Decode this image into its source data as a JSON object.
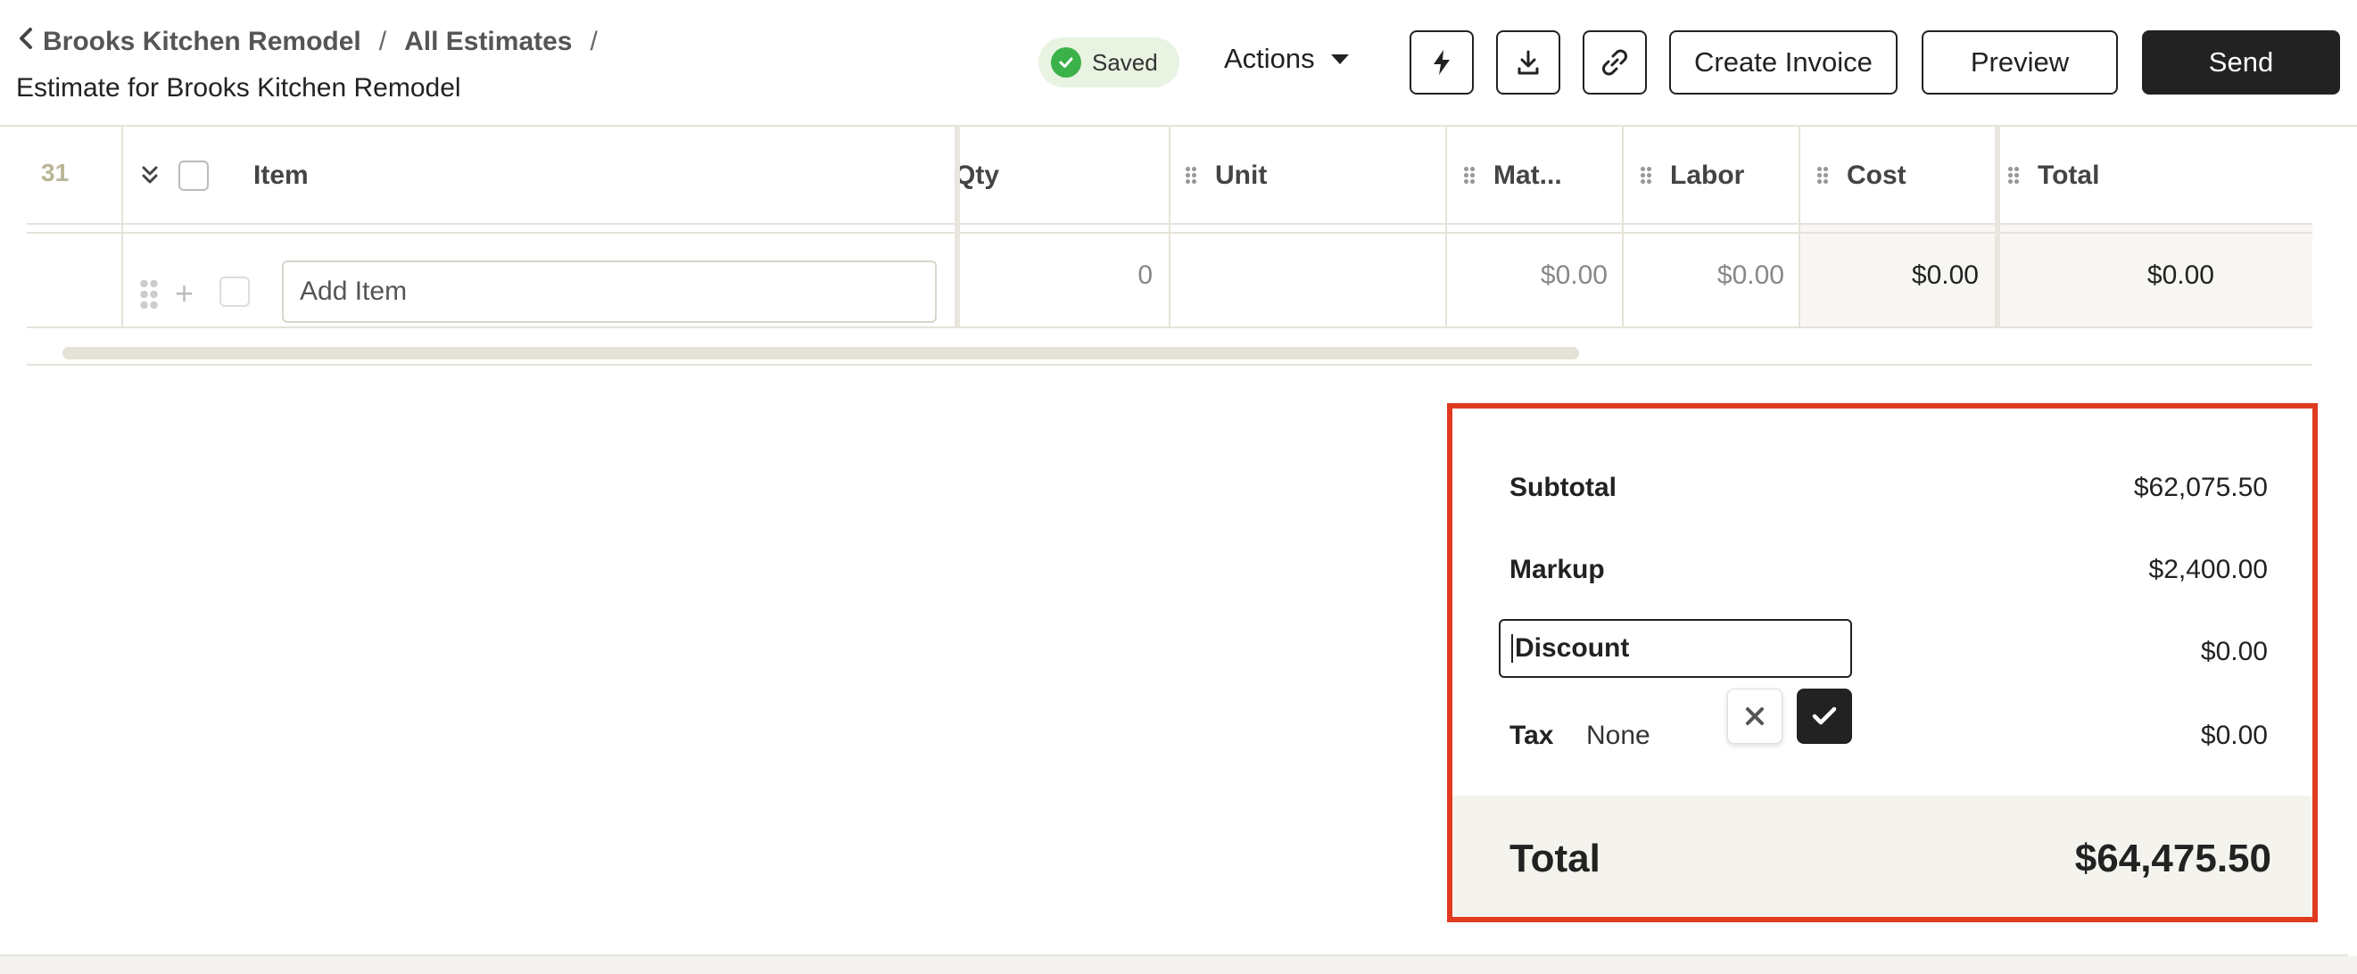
{
  "breadcrumb": {
    "project": "Brooks Kitchen Remodel",
    "estimates": "All Estimates",
    "separator": "/"
  },
  "page_title": "Estimate for Brooks Kitchen Remodel",
  "status": {
    "label": "Saved",
    "color": "#3bb14a"
  },
  "toolbar": {
    "actions_label": "Actions",
    "icons": [
      "lightning-icon",
      "download-icon",
      "link-icon"
    ],
    "create_invoice_label": "Create Invoice",
    "preview_label": "Preview",
    "send_label": "Send"
  },
  "table": {
    "row_number": "31",
    "columns": [
      "Item",
      "Qty",
      "Unit",
      "Mat...",
      "Labor",
      "Cost",
      "Total"
    ],
    "add_row": {
      "placeholder": "Add Item",
      "qty": "0",
      "unit": "",
      "material": "$0.00",
      "labor": "$0.00",
      "cost": "$0.00",
      "total": "$0.00"
    }
  },
  "summary": {
    "subtotal_label": "Subtotal",
    "subtotal_value": "$62,075.50",
    "markup_label": "Markup",
    "markup_value": "$2,400.00",
    "discount_label": "Discount",
    "discount_value": "$0.00",
    "tax_label": "Tax",
    "tax_rate": "None",
    "tax_value": "$0.00",
    "total_label": "Total",
    "total_value": "$64,475.50",
    "highlight_color": "#e03a20"
  }
}
